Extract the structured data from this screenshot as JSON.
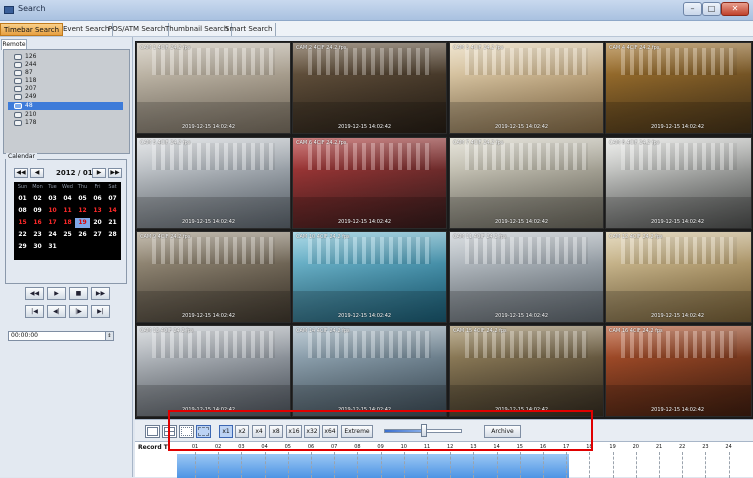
{
  "window": {
    "title": "Search"
  },
  "modes": [
    "Timebar Search",
    "Event Search",
    "POS/ATM Search",
    "Thumbnail Search",
    "Smart Search"
  ],
  "active_mode": 0,
  "remote": {
    "tab_label": "Remote"
  },
  "tree": {
    "items": [
      "126",
      "244",
      "87",
      "118",
      "207",
      "249",
      "48",
      "210",
      "178"
    ],
    "selected_index": 6
  },
  "calendar": {
    "label": "Calendar",
    "month_label": "2012 / 01",
    "weekday_headers": [
      "Sun",
      "Mon",
      "Tue",
      "Wed",
      "Thu",
      "Fri",
      "Sat"
    ],
    "weeks": [
      [
        "01",
        "02",
        "03",
        "04",
        "05",
        "06",
        "07"
      ],
      [
        "08",
        "09",
        "10",
        "11",
        "12",
        "13",
        "14"
      ],
      [
        "15",
        "16",
        "17",
        "18",
        "19",
        "20",
        "21"
      ],
      [
        "22",
        "23",
        "24",
        "25",
        "26",
        "27",
        "28"
      ],
      [
        "29",
        "30",
        "31",
        "",
        "",
        "",
        ""
      ]
    ],
    "recorded_days": [
      "10",
      "11",
      "12",
      "13",
      "14",
      "15",
      "16",
      "17",
      "18"
    ],
    "selected_day": "19",
    "nav": [
      "◀◀",
      "◀",
      "▶",
      "▶▶"
    ]
  },
  "playback": {
    "row1": [
      "◀◀",
      "▶",
      "■",
      "▶▶"
    ],
    "row2": [
      "|◀",
      "◀|",
      "|▶",
      "▶|"
    ],
    "time_value": "00:00:00",
    "spin_glyph": "⇕"
  },
  "tiles": [
    {
      "caption": "CAM 1 4CIF 24.2 fps",
      "timestamp": "2019-12-15 14:02:42",
      "c1": "#c9c2b4",
      "c2": "#8d8170"
    },
    {
      "caption": "CAM 2 4CIF 24.2 fps",
      "timestamp": "2019-12-15 14:02:42",
      "c1": "#6d5a43",
      "c2": "#2c2218"
    },
    {
      "caption": "CAM 3 4CIF 24.2 fps",
      "timestamp": "2019-12-15 14:02:42",
      "c1": "#e6d6b6",
      "c2": "#9b7d52"
    },
    {
      "caption": "CAM 4 4CIF 24.2 fps",
      "timestamp": "2019-12-15 14:02:42",
      "c1": "#a7772f",
      "c2": "#4f3a1c"
    },
    {
      "caption": "CAM 5 4CIF 24.2 fps",
      "timestamp": "2019-12-15 14:02:42",
      "c1": "#d5d8db",
      "c2": "#6c7680"
    },
    {
      "caption": "CAM 6 4CIF 24.2 fps",
      "timestamp": "2019-12-15 14:02:42",
      "c1": "#b23a3a",
      "c2": "#3d2020"
    },
    {
      "caption": "CAM 7 4CIF 24.2 fps",
      "timestamp": "2019-12-15 14:02:42",
      "c1": "#d9d6c8",
      "c2": "#7a776b"
    },
    {
      "caption": "CAM 8 4CIF 24.2 fps",
      "timestamp": "2019-12-15 14:02:42",
      "c1": "#e3e4e1",
      "c2": "#5b5d5c"
    },
    {
      "caption": "CAM 9 4CIF 24.2 fps",
      "timestamp": "2019-12-15 14:02:42",
      "c1": "#a39884",
      "c2": "#4a4135"
    },
    {
      "caption": "CAM 10 4CIF 24.2 fps",
      "timestamp": "2019-12-15 14:02:42",
      "c1": "#7ec3d8",
      "c2": "#1e6a86"
    },
    {
      "caption": "CAM 11 4CIF 24.2 fps",
      "timestamp": "2019-12-15 14:02:42",
      "c1": "#c6ccd1",
      "c2": "#6d7780"
    },
    {
      "caption": "CAM 12 4CIF 24.2 fps",
      "timestamp": "2019-12-15 14:02:42",
      "c1": "#d7c7a0",
      "c2": "#8a6f3f"
    },
    {
      "caption": "CAM 13 4CIF 24.2 fps",
      "timestamp": "2019-12-15 14:02:42",
      "c1": "#c9cdd1",
      "c2": "#5e6670"
    },
    {
      "caption": "CAM 14 4CIF 24.2 fps",
      "timestamp": "2019-12-15 14:02:42",
      "c1": "#9fb3c0",
      "c2": "#485a67"
    },
    {
      "caption": "CAM 15 4CIF 24.2 fps",
      "timestamp": "2019-12-15 14:02:42",
      "c1": "#9e8b63",
      "c2": "#3f3527"
    },
    {
      "caption": "CAM 16 4CIF 24.2 fps",
      "timestamp": "2019-12-15 14:02:42",
      "c1": "#b5542d",
      "c2": "#4a2312"
    }
  ],
  "toolbar": {
    "speed_buttons": [
      "x1",
      "x2",
      "x4",
      "x8",
      "x16",
      "x32",
      "x64",
      "Extreme"
    ],
    "active_speed_index": 0,
    "active_layout_index": 3,
    "archive_label": "Archive",
    "slider_fraction": 0.5
  },
  "timeline": {
    "label": "Record Ti",
    "hours": [
      "01",
      "02",
      "03",
      "04",
      "05",
      "06",
      "07",
      "08",
      "09",
      "10",
      "11",
      "12",
      "13",
      "14",
      "15",
      "16",
      "17",
      "18",
      "19",
      "20",
      "21",
      "22",
      "23",
      "24"
    ],
    "recorded_until_hour": 18
  },
  "colors": {
    "active_tab": "#e7a040",
    "selection": "#3d7bd9",
    "record_bar": "#4d94e4",
    "highlight_box": "#e00000"
  }
}
